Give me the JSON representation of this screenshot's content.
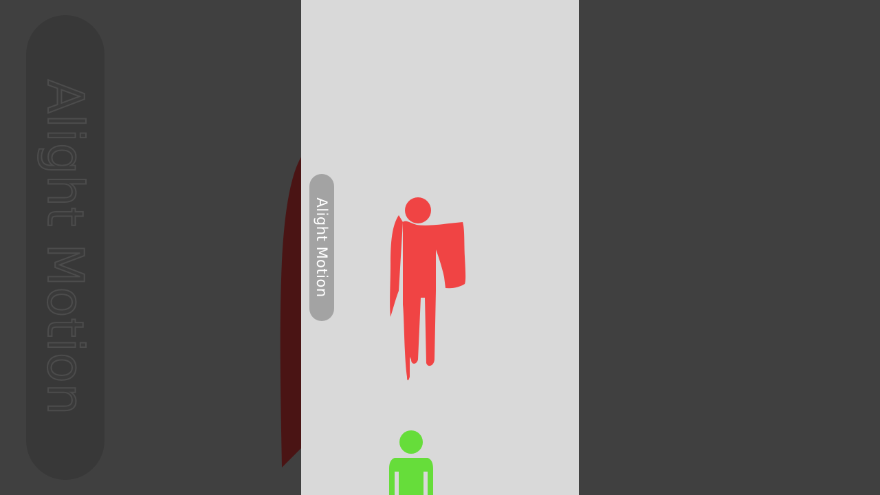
{
  "watermark": {
    "label": "Alight Motion"
  },
  "background": {
    "watermark_label": "Alight Motion"
  },
  "colors": {
    "red_figure": "#f04444",
    "green_figure": "#66dd3a",
    "frame_background": "#d9d9d9",
    "outer_background": "#404040",
    "watermark_pill": "#a3a3a3"
  }
}
